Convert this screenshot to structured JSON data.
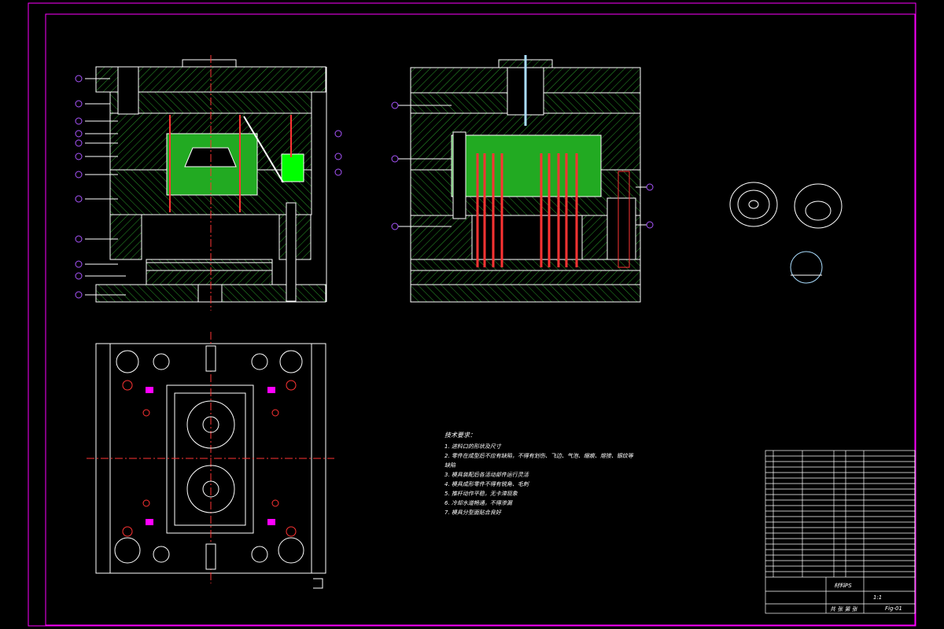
{
  "drawing": {
    "title": "技术要求：",
    "notes": [
      "1. 进料口的形状及尺寸",
      "2. 零件在成型后不应有缺陷，不得有划伤、飞边、气泡、缩痕、熔接、银纹等",
      "   缺陷",
      "3. 模具装配后各活动部件运行灵活",
      "4. 模具成形零件不得有锐角、毛刺",
      "5. 推杆动作平稳，无卡滞现象",
      "6. 冷却水道畅通，不得渗漏",
      "7. 模具分型面贴合良好"
    ],
    "material_label": "材料PS",
    "scale_label": "1:1",
    "sheet_label": "共 张 第 张",
    "drawing_no": "Fig-01",
    "colors": {
      "frame": "#ff00ff",
      "line": "#ffffff",
      "hatch": "#22bb22",
      "cavity": "#00ff00",
      "center": "#ff3333",
      "balloon": "#aa55ff"
    }
  }
}
